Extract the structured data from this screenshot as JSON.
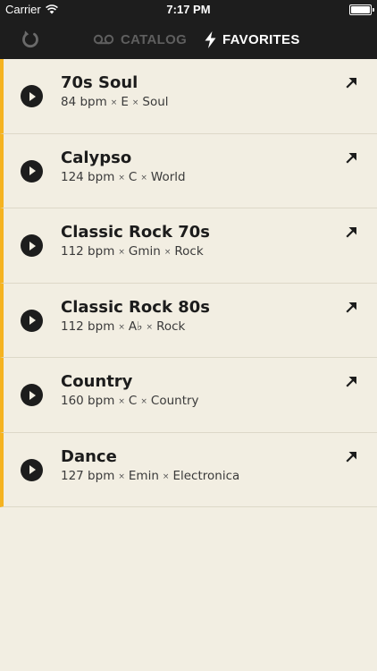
{
  "status_bar": {
    "carrier": "Carrier",
    "time": "7:17 PM",
    "battery_level": 1.0
  },
  "nav": {
    "refresh_icon": "refresh-icon",
    "tabs": [
      {
        "label": "CATALOG",
        "icon": "tape-icon",
        "active": false
      },
      {
        "label": "FAVORITES",
        "icon": "lightning-icon",
        "active": true
      }
    ]
  },
  "colors": {
    "accent": "#f5b320",
    "bar_bg": "#1d1d1d",
    "list_bg": "#f2eee2",
    "inactive_tab": "#5f5f5f"
  },
  "meta_separator": "×",
  "favorites": [
    {
      "title": "70s Soul",
      "bpm": "84 bpm",
      "key": "E",
      "genre": "Soul"
    },
    {
      "title": "Calypso",
      "bpm": "124 bpm",
      "key": "C",
      "genre": "World"
    },
    {
      "title": "Classic Rock 70s",
      "bpm": "112 bpm",
      "key": "Gmin",
      "genre": "Rock"
    },
    {
      "title": "Classic Rock 80s",
      "bpm": "112 bpm",
      "key": "A♭",
      "genre": "Rock"
    },
    {
      "title": "Country",
      "bpm": "160 bpm",
      "key": "C",
      "genre": "Country"
    },
    {
      "title": "Dance",
      "bpm": "127 bpm",
      "key": "Emin",
      "genre": "Electronica"
    }
  ]
}
